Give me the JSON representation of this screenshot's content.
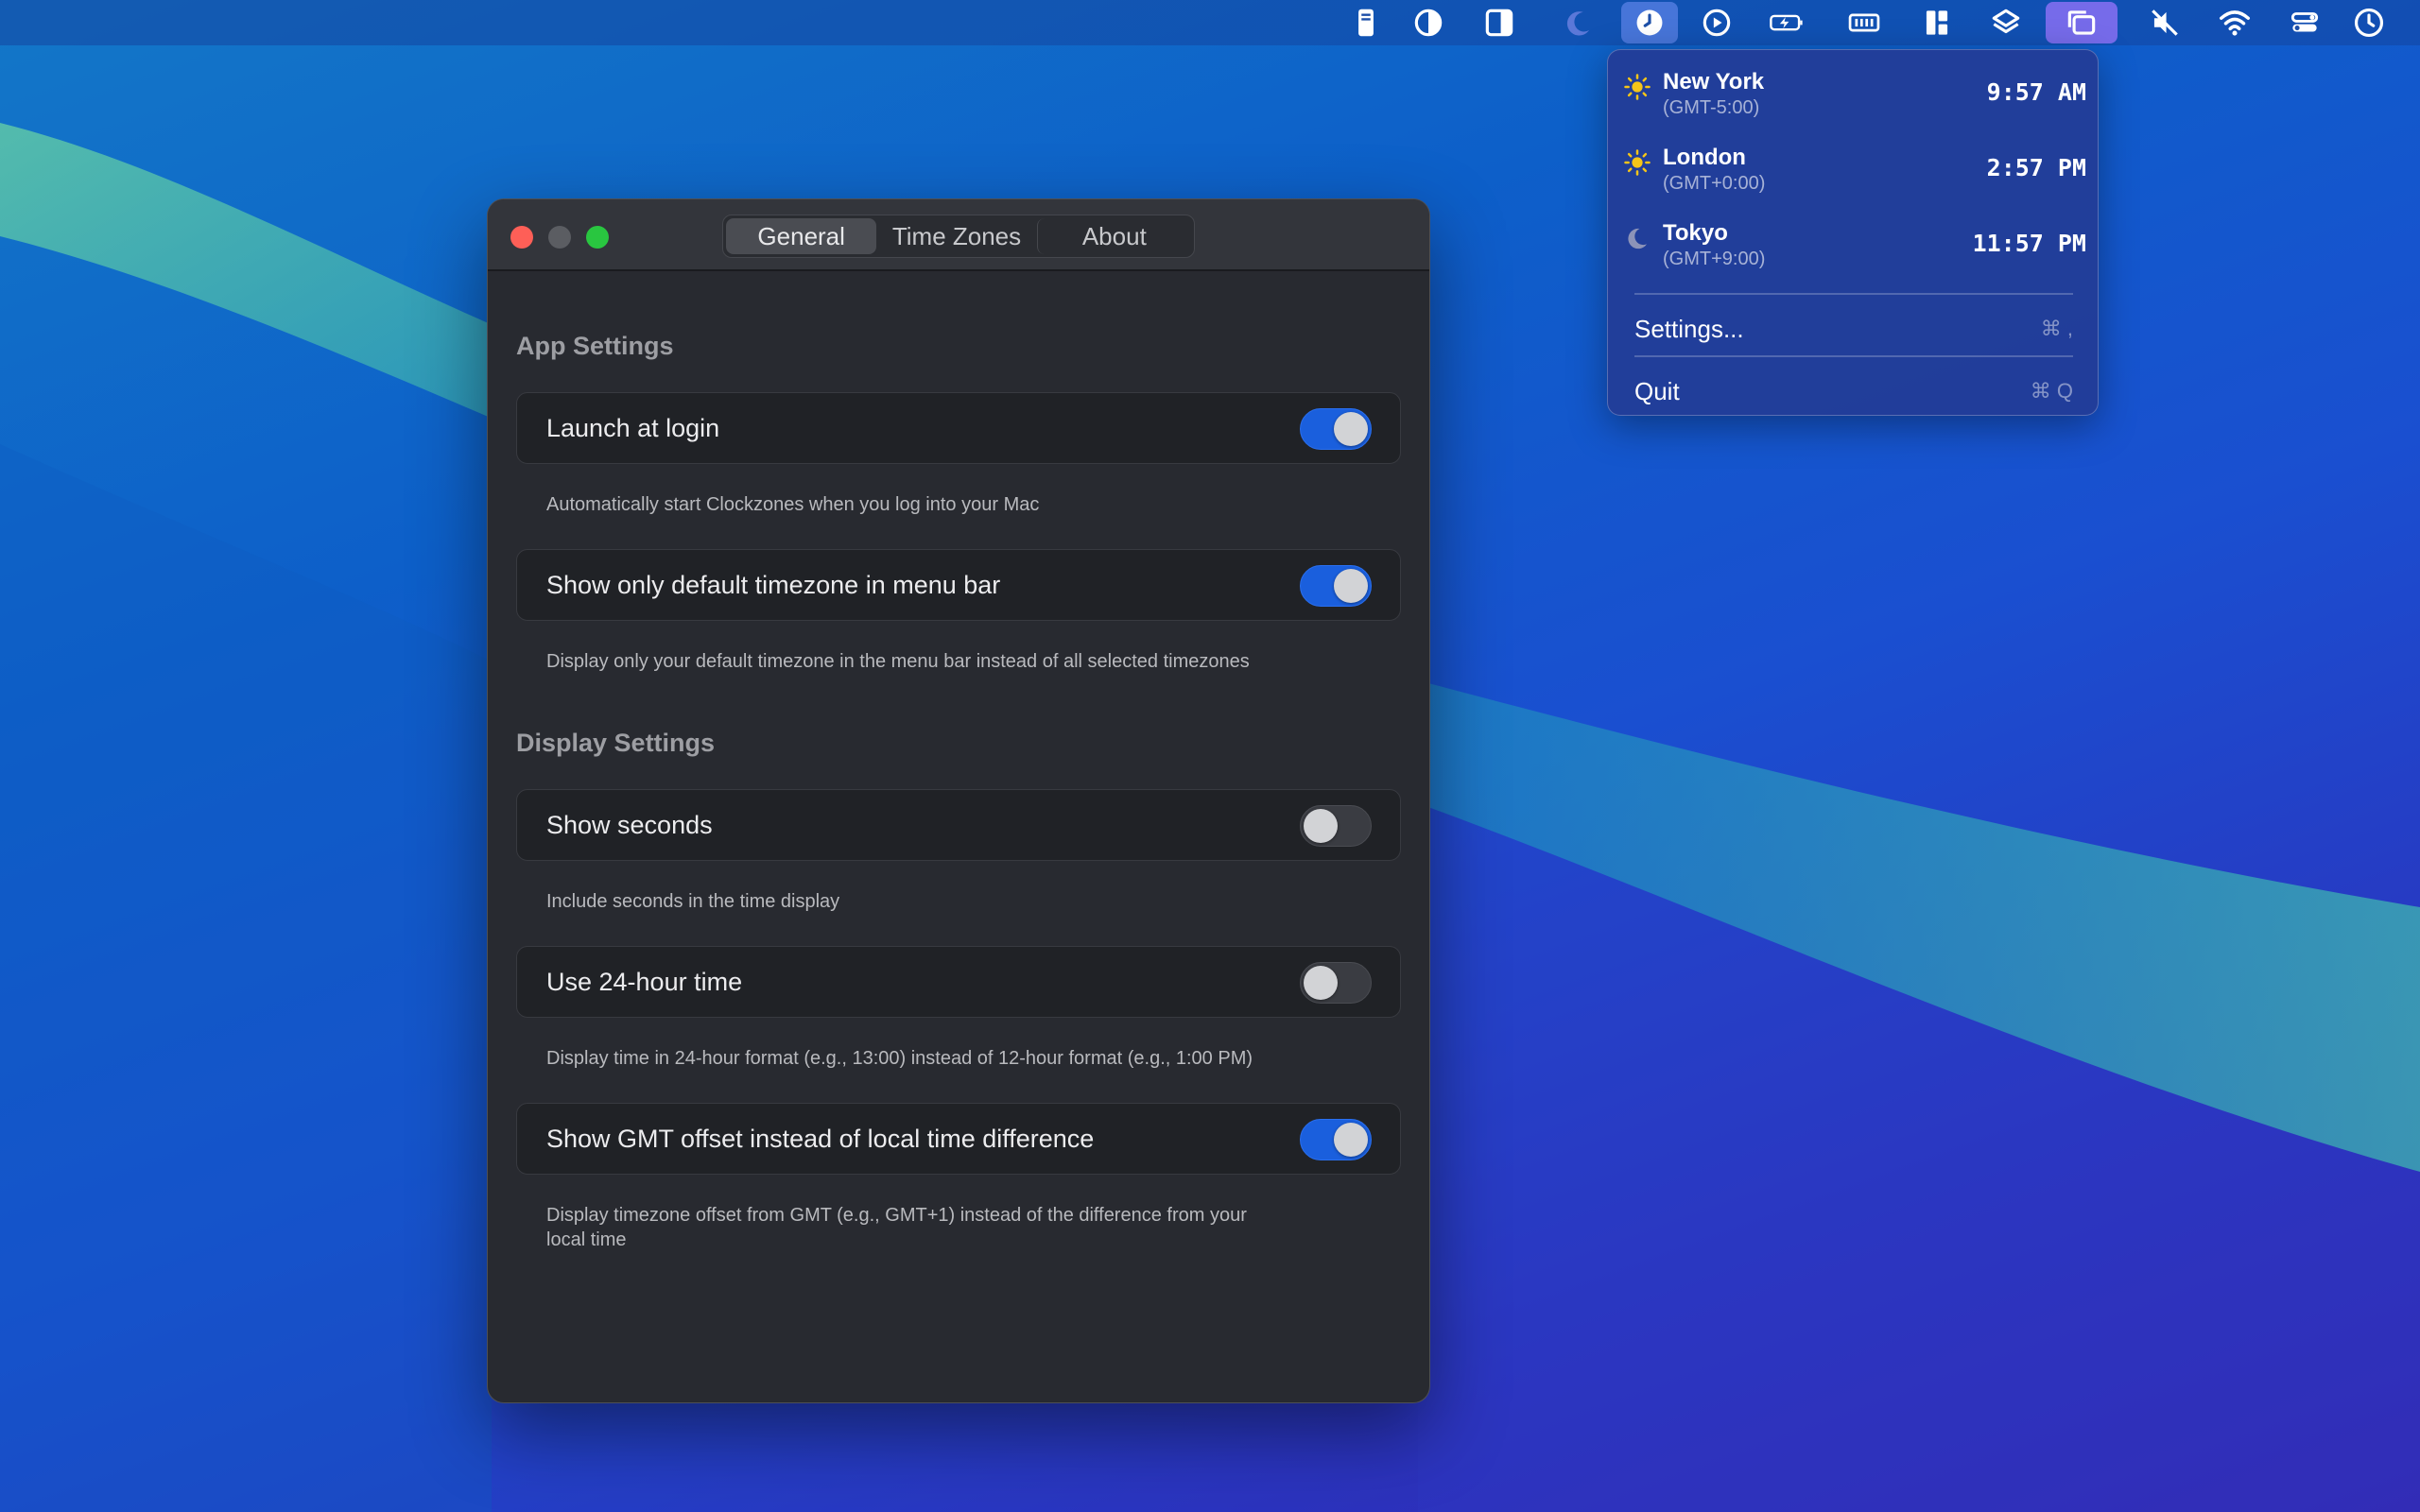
{
  "menubar": {
    "icons": [
      "clipboard-icon",
      "contrast-icon",
      "sidebar-icon",
      "moon-icon",
      "clock-app-icon",
      "play-icon",
      "battery-charging-icon",
      "memory-icon",
      "layout-icon",
      "layers-icon",
      "windows-icon",
      "mute-icon",
      "wifi-icon",
      "control-center-icon",
      "clock-icon"
    ]
  },
  "dropdown": {
    "timezones": [
      {
        "name": "New York",
        "offset": "(GMT-5:00)",
        "time": "9:57 AM",
        "icon": "sun-icon"
      },
      {
        "name": "London",
        "offset": "(GMT+0:00)",
        "time": "2:57 PM",
        "icon": "sun-icon"
      },
      {
        "name": "Tokyo",
        "offset": "(GMT+9:00)",
        "time": "11:57 PM",
        "icon": "moon-icon"
      }
    ],
    "settings": {
      "label": "Settings...",
      "shortcut": "⌘ ,"
    },
    "quit": {
      "label": "Quit",
      "shortcut": "⌘ Q"
    }
  },
  "window": {
    "tabs": {
      "general": "General",
      "time_zones": "Time Zones",
      "about": "About"
    },
    "sections": {
      "app": "App Settings",
      "display": "Display Settings"
    },
    "settings": [
      {
        "label": "Launch at login",
        "enabled": true,
        "description": "Automatically start Clockzones when you log into your Mac"
      },
      {
        "label": "Show only default timezone in menu bar",
        "enabled": true,
        "description": "Display only your default timezone in the menu bar instead of all selected timezones"
      },
      {
        "label": "Show seconds",
        "enabled": false,
        "description": "Include seconds in the time display"
      },
      {
        "label": "Use 24-hour time",
        "enabled": false,
        "description": "Display time in 24-hour format (e.g., 13:00) instead of 12-hour format (e.g., 1:00 PM)"
      },
      {
        "label": "Show GMT offset instead of local time difference",
        "enabled": true,
        "description_line1": "Display timezone offset from GMT (e.g., GMT+1) instead of the difference from your",
        "description_line2": "local time"
      }
    ]
  },
  "colors": {
    "toggle_on": "#1a5fdd",
    "close": "#fe5f57",
    "maximize": "#29c640"
  }
}
